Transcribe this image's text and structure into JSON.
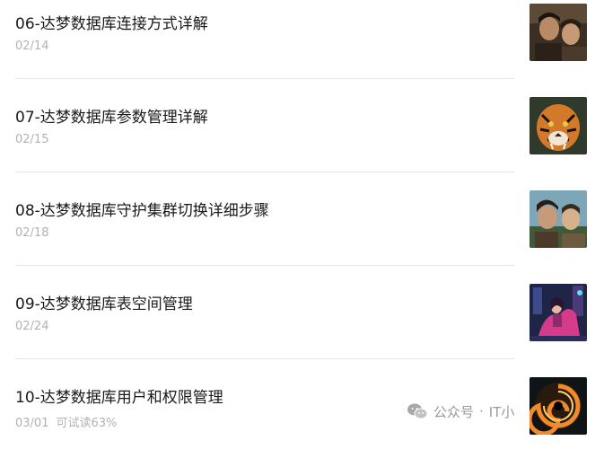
{
  "articles": [
    {
      "title": "06-达梦数据库连接方式详解",
      "date": "02/14",
      "extra": "",
      "thumbnail_icon": "portrait-two-men-thumbnail-icon"
    },
    {
      "title": "07-达梦数据库参数管理详解",
      "date": "02/15",
      "extra": "",
      "thumbnail_icon": "tiger-thumbnail-icon"
    },
    {
      "title": "08-达梦数据库守护集群切换详细步骤",
      "date": "02/18",
      "extra": "",
      "thumbnail_icon": "portrait-men-thumbnail-icon"
    },
    {
      "title": "09-达梦数据库表空间管理",
      "date": "02/24",
      "extra": "",
      "thumbnail_icon": "neon-rider-thumbnail-icon"
    },
    {
      "title": "10-达梦数据库用户和权限管理",
      "date": "03/01",
      "extra": "可试读63%",
      "thumbnail_icon": "spiral-vortex-thumbnail-icon"
    }
  ],
  "watermark": {
    "brand": "公众号",
    "separator": "·",
    "account": "IT小"
  }
}
